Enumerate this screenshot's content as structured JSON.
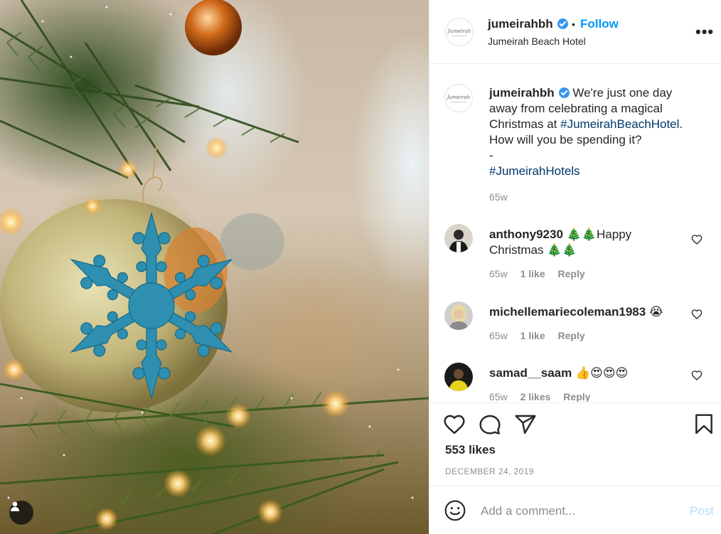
{
  "post": {
    "username": "jumeirahbh",
    "follow_label": "Follow",
    "separator": "•",
    "location": "Jumeirah Beach Hotel",
    "more_label": "•••",
    "avatar_text": "Jumeirah"
  },
  "caption": {
    "username": "jumeirahbh",
    "text_before": "We're just one day away from celebrating a magical Christmas at ",
    "hashtag1": "#JumeirahBeachHotel",
    "text_after": ". How will you be spending it?",
    "dash": "-",
    "hashtag2": "#JumeirahHotels",
    "time": "65w"
  },
  "comments": [
    {
      "username": "anthony9230",
      "text": "🎄🎄Happy Christmas 🎄🎄",
      "time": "65w",
      "likes": "1 like",
      "reply": "Reply"
    },
    {
      "username": "michellemariecoleman1983",
      "text": "😭",
      "time": "65w",
      "likes": "1 like",
      "reply": "Reply"
    },
    {
      "username": "samad__saam",
      "text": "👍😍😍😍",
      "time": "65w",
      "likes": "2 likes",
      "reply": "Reply"
    }
  ],
  "stats": {
    "likes": "553 likes",
    "date": "DECEMBER 24, 2019"
  },
  "add_comment": {
    "placeholder": "Add a comment...",
    "post_label": "Post"
  },
  "colors": {
    "link": "#0095f6",
    "hashtag": "#00376b",
    "verified": "#3897f0",
    "muted": "#8e8e8e"
  }
}
